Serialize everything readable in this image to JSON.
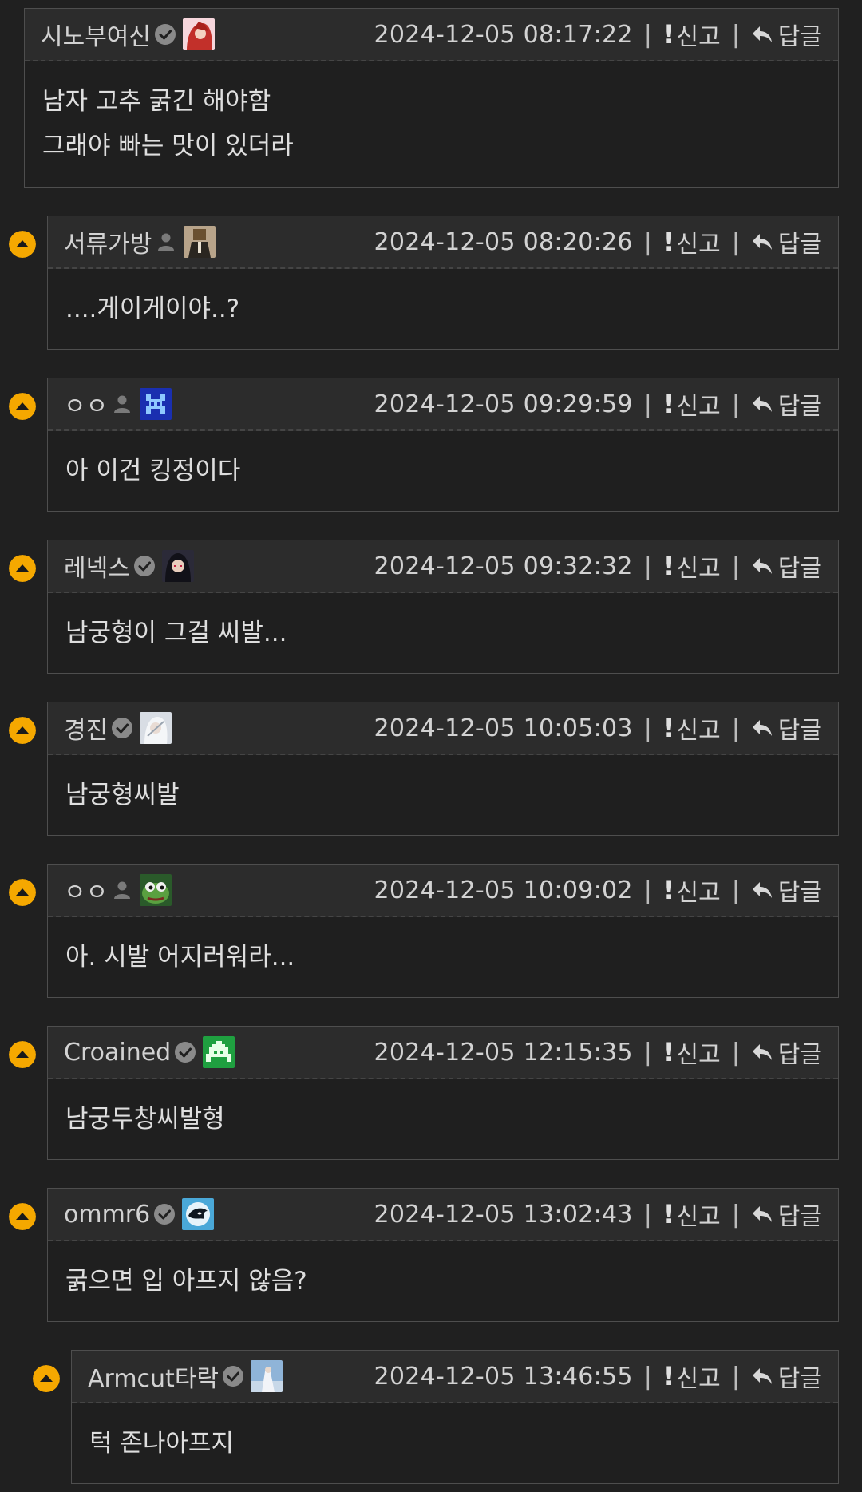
{
  "labels": {
    "report": "신고",
    "reply": "답글"
  },
  "colors": {
    "upvote_badge": "#f5a800",
    "header_bg": "#2c2c2c",
    "page_bg": "#202020"
  },
  "comments": [
    {
      "author": "시노부여신",
      "badge": "verified",
      "avatar": "red-hair-character",
      "date": "2024-12-05 08:17:22",
      "lines": [
        "남자 고추 굵긴 해야함",
        "그래야 빠는 맛이 있더라"
      ]
    },
    {
      "author": "서류가방",
      "badge": "member",
      "avatar": "suit-figure",
      "date": "2024-12-05 08:20:26",
      "lines": [
        "....게이게이야..?"
      ]
    },
    {
      "author": "ㅇㅇ",
      "badge": "member",
      "avatar": "pixel-invader-blue",
      "date": "2024-12-05 09:29:59",
      "lines": [
        "아 이건 킹정이다"
      ]
    },
    {
      "author": "레넥스",
      "badge": "verified",
      "avatar": "dark-anime-character",
      "date": "2024-12-05 09:32:32",
      "lines": [
        "남궁형이 그걸 씨발..."
      ]
    },
    {
      "author": "경진",
      "badge": "verified",
      "avatar": "white-hair-character",
      "date": "2024-12-05 10:05:03",
      "lines": [
        "남궁형씨발"
      ]
    },
    {
      "author": "ㅇㅇ",
      "badge": "member",
      "avatar": "green-frog",
      "date": "2024-12-05 10:09:02",
      "lines": [
        "아. 시발 어지러워라..."
      ]
    },
    {
      "author": "Croained",
      "badge": "verified",
      "avatar": "pixel-invader-green",
      "date": "2024-12-05 12:15:35",
      "lines": [
        "남궁두창씨발형"
      ]
    },
    {
      "author": "ommr6",
      "badge": "verified",
      "avatar": "orca-icon",
      "date": "2024-12-05 13:02:43",
      "lines": [
        "굵으면 입 아프지 않음?"
      ]
    },
    {
      "author": "Armcut타락",
      "badge": "verified",
      "avatar": "blue-sky-character",
      "date": "2024-12-05 13:46:55",
      "lines": [
        "턱 존나아프지"
      ]
    }
  ]
}
